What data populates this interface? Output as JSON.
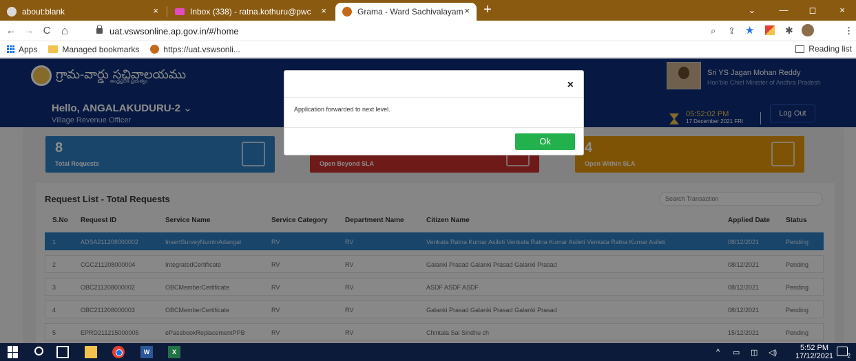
{
  "browser": {
    "tabs": [
      {
        "title": "about:blank",
        "active": false
      },
      {
        "title": "Inbox (338) - ratna.kothuru@pwc",
        "active": false
      },
      {
        "title": "Grama - Ward Sachivalayam",
        "active": true
      }
    ],
    "new_tab": "+",
    "close_glyph": "×",
    "window_controls": {
      "dropdown": "⌄",
      "minimize": "—",
      "maximize": "◻",
      "close": "×"
    },
    "nav": {
      "back": "←",
      "forward": "→",
      "reload": "C",
      "home": "⌂"
    },
    "url": "uat.vswsonline.ap.gov.in/#/home",
    "omnibox_icons": [
      "zoom-icon",
      "share-icon",
      "star-icon",
      "extensions-icon",
      "puzzle-icon",
      "profile-icon",
      "menu-icon"
    ],
    "bookmarks": [
      {
        "label": "Apps",
        "icon": "apps-grid-icon"
      },
      {
        "label": "Managed bookmarks",
        "icon": "folder-icon"
      },
      {
        "label": "https://uat.vswsonli...",
        "icon": "globe-icon"
      }
    ],
    "reading_list": "Reading list"
  },
  "header": {
    "brand_title": "గ్రామ-వార్డు సచివాలయము",
    "brand_subtitle": "ఆంధ్రప్రదేశ్ ప్రభుత్వం",
    "greeting": "Hello, ANGALAKUDURU-2",
    "greeting_chevron": "⌄",
    "role": "Village Revenue Officer",
    "cm_name": "Sri YS Jagan Mohan Reddy",
    "cm_title": "Hon'ble Chief Minister of Andhra Pradesh",
    "time": "05:52:02 PM",
    "date": "17 December 2021 FRI",
    "logout": "Log Out"
  },
  "stats": [
    {
      "value": "8",
      "label": "Total Requests",
      "color": "#2f7fc4"
    },
    {
      "value": "",
      "label": "Open Beyond SLA",
      "color": "#c9302c"
    },
    {
      "value": "4",
      "label": "Open Within SLA",
      "color": "#e8970a"
    }
  ],
  "list": {
    "title": "Request List - Total Requests",
    "search_placeholder": "Search Transaction",
    "columns": [
      "S.No",
      "Request ID",
      "Service Name",
      "Service Category",
      "Department Name",
      "Citizen Name",
      "Applied Date",
      "Status"
    ],
    "rows": [
      {
        "sno": "1",
        "request_id": "ADSA211208000002",
        "service": "InsertSurveyNumInAdangal",
        "category": "RV",
        "department": "RV",
        "citizen": "Venkata Ratna Kumar Asileti Venkata Ratna Kumar Asileti Venkata Ratna Kumar Asileti",
        "date": "08/12/2021",
        "status": "Pending",
        "selected": true
      },
      {
        "sno": "2",
        "request_id": "CGC211208000004",
        "service": "IntegratedCertificate",
        "category": "RV",
        "department": "RV",
        "citizen": "Galanki Prasad Galanki Prasad Galanki Prasad",
        "date": "08/12/2021",
        "status": "Pending",
        "selected": false
      },
      {
        "sno": "3",
        "request_id": "OBC211208000002",
        "service": "OBCMemberCertificate",
        "category": "RV",
        "department": "RV",
        "citizen": "ASDF ASDF ASDF",
        "date": "08/12/2021",
        "status": "Pending",
        "selected": false
      },
      {
        "sno": "4",
        "request_id": "OBC211208000003",
        "service": "OBCMemberCertificate",
        "category": "RV",
        "department": "RV",
        "citizen": "Galanki Prasad Galanki Prasad Galanki Prasad",
        "date": "08/12/2021",
        "status": "Pending",
        "selected": false
      },
      {
        "sno": "5",
        "request_id": "EPRD211215000005",
        "service": "ePassbookReplacementPPB",
        "category": "RV",
        "department": "RV",
        "citizen": "Chintala Sai Sindhu ch",
        "date": "15/12/2021",
        "status": "Pending",
        "selected": false
      }
    ]
  },
  "modal": {
    "close": "×",
    "message": "Application forwarded to next level.",
    "ok": "Ok"
  },
  "taskbar": {
    "time": "5:52 PM",
    "date": "17/12/2021",
    "tray_chevron": "^",
    "notification_count": "2"
  }
}
